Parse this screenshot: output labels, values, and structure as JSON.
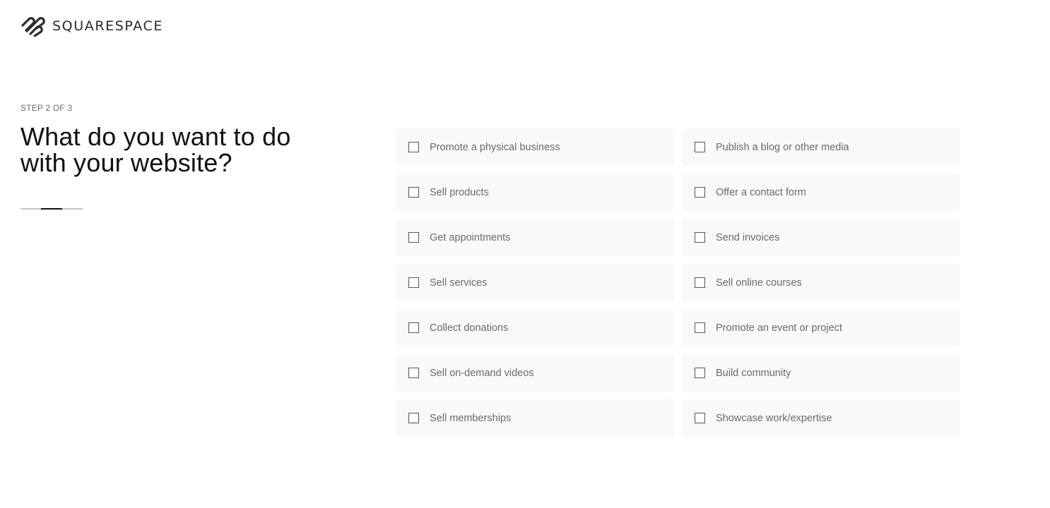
{
  "header": {
    "logo_text": "SQUARESPACE",
    "logo_icon": "squarespace-logo-icon"
  },
  "step": {
    "label": "STEP 2 OF 3",
    "current": 2,
    "total": 3
  },
  "question": {
    "title": "What do you want to do with your website?"
  },
  "options": [
    {
      "label": "Promote a physical business",
      "checked": false
    },
    {
      "label": "Publish a blog or other media",
      "checked": false
    },
    {
      "label": "Sell products",
      "checked": false
    },
    {
      "label": "Offer a contact form",
      "checked": false
    },
    {
      "label": "Get appointments",
      "checked": false
    },
    {
      "label": "Send invoices",
      "checked": false
    },
    {
      "label": "Sell services",
      "checked": false
    },
    {
      "label": "Sell online courses",
      "checked": false
    },
    {
      "label": "Collect donations",
      "checked": false
    },
    {
      "label": "Promote an event or project",
      "checked": false
    },
    {
      "label": "Sell on-demand videos",
      "checked": false
    },
    {
      "label": "Build community",
      "checked": false
    },
    {
      "label": "Sell memberships",
      "checked": false
    },
    {
      "label": "Showcase work/expertise",
      "checked": false
    }
  ],
  "colors": {
    "text_primary": "#111111",
    "text_secondary": "#6a6a6a",
    "tile_background": "#f9f9f9",
    "progress_active": "#111111",
    "progress_inactive": "#c4c4c4"
  }
}
